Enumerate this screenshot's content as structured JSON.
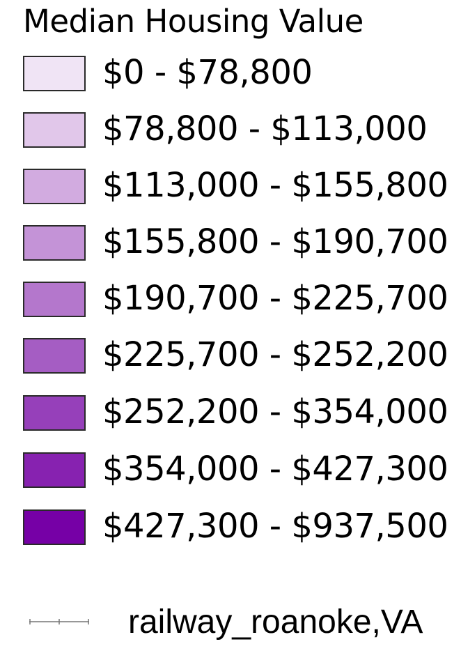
{
  "legend": {
    "title": "Median Housing Value",
    "items": [
      {
        "label": "$0 - $78,800",
        "color": "#f0e4f5"
      },
      {
        "label": "$78,800 - $113,000",
        "color": "#e1c7ea"
      },
      {
        "label": "$113,000 - $155,800",
        "color": "#d2abe0"
      },
      {
        "label": "$155,800 - $190,700",
        "color": "#c493d7"
      },
      {
        "label": "$190,700 - $225,700",
        "color": "#b477cc"
      },
      {
        "label": "$225,700 - $252,200",
        "color": "#a55dc3"
      },
      {
        "label": "$252,200 - $354,000",
        "color": "#9640ba"
      },
      {
        "label": "$354,000 - $427,300",
        "color": "#8722b0"
      },
      {
        "label": "$427,300 - $937,500",
        "color": "#7600a6"
      }
    ],
    "railway": {
      "label": "railway_roanoke,VA",
      "line_color": "#777777"
    }
  }
}
